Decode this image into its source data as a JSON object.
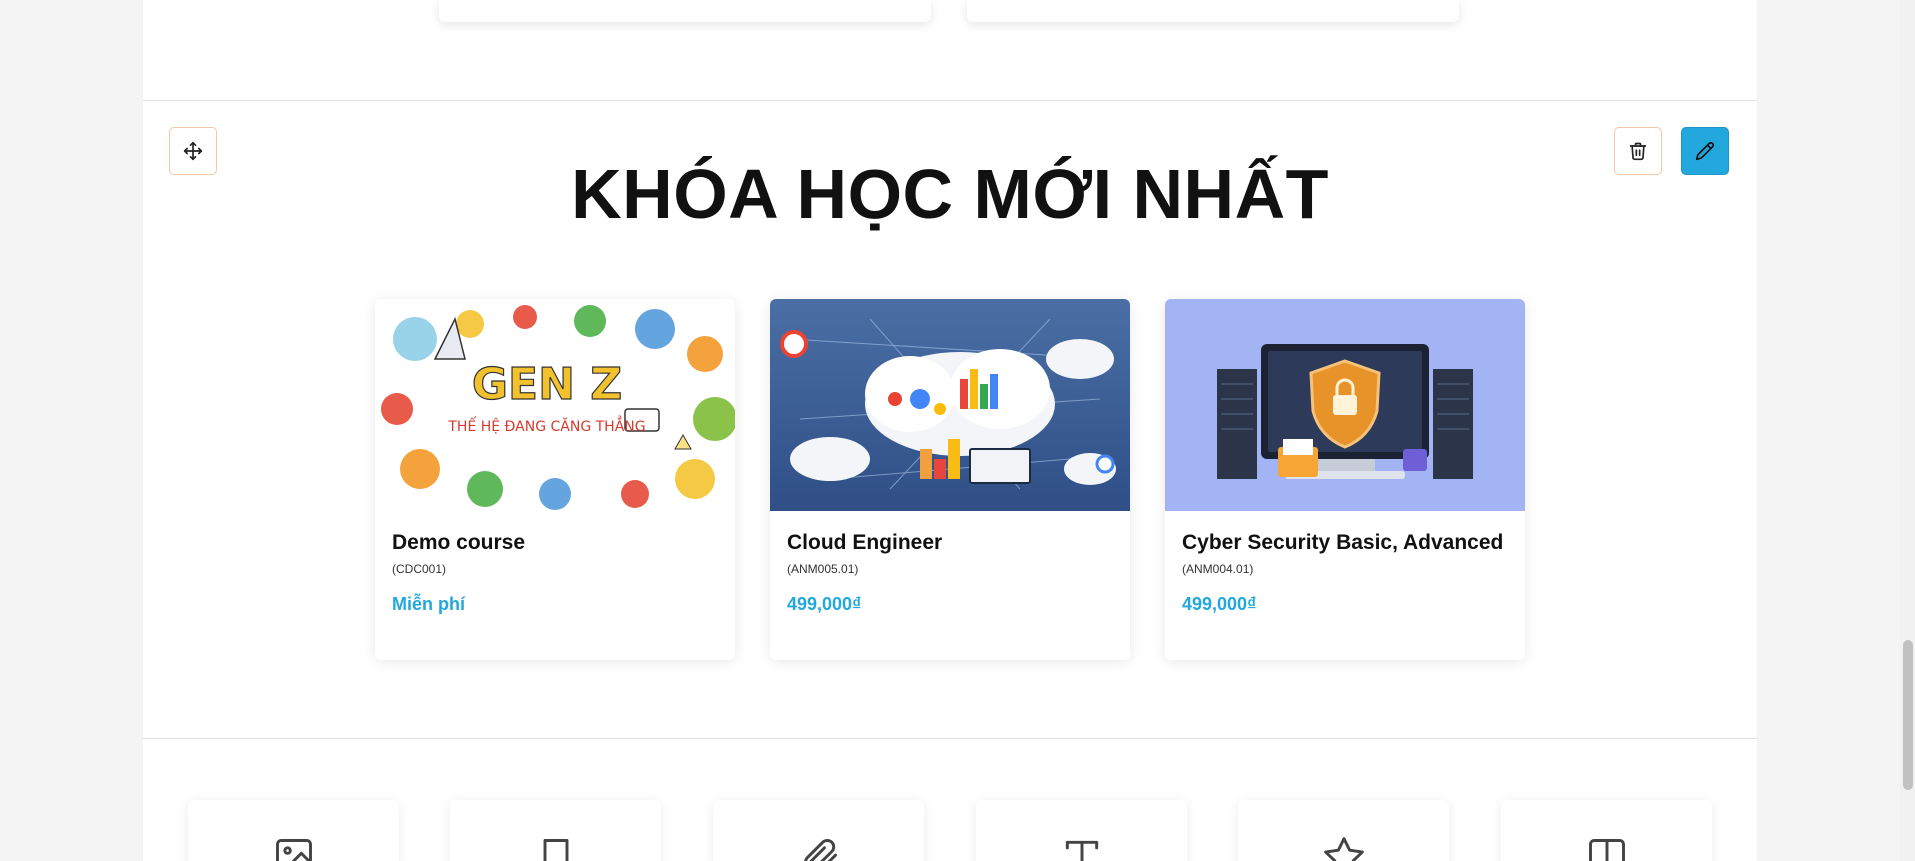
{
  "section": {
    "title": "KHÓA HỌC MỚI NHẤT"
  },
  "toolbar": {
    "move_icon": "move-icon",
    "delete_icon": "trash-icon",
    "edit_icon": "pencil-icon",
    "accent_color": "#22a8dc"
  },
  "courses": [
    {
      "name": "Demo course",
      "code": "(CDC001)",
      "price": "Miễn phí",
      "image_text": {
        "title": "GEN Z",
        "subtitle": "THẾ HỆ ĐANG CĂNG THẲNG"
      }
    },
    {
      "name": "Cloud Engineer",
      "code": "(ANM005.01)",
      "price": "499,000₫"
    },
    {
      "name": "Cyber Security Basic, Advanced",
      "code": "(ANM004.01)",
      "price": "499,000₫"
    }
  ],
  "widgets": [
    {
      "icon": "image-icon"
    },
    {
      "icon": "bookmark-icon"
    },
    {
      "icon": "paperclip-icon"
    },
    {
      "icon": "text-icon"
    },
    {
      "icon": "star-icon"
    },
    {
      "icon": "columns-icon"
    }
  ]
}
